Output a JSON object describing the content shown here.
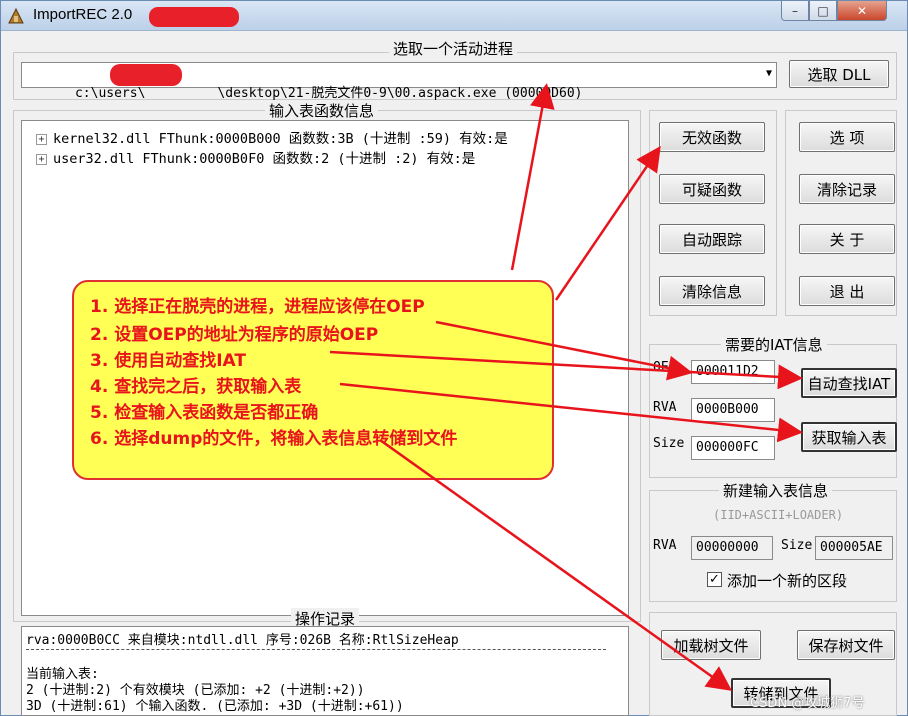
{
  "window": {
    "title": "ImportREC 2.0",
    "min": "–",
    "max": "□",
    "close": "✕"
  },
  "process": {
    "group_title": "选取一个活动进程",
    "path_a": "c:\\users\\",
    "path_b": "\\desktop\\21-脱壳文件0-9\\00.aspack.exe (00000D60)",
    "pick_dll": "选取 DLL"
  },
  "imports": {
    "group_title": "输入表函数信息",
    "items": [
      "kernel32.dll FThunk:0000B000 函数数:3B (十进制 :59) 有效:是",
      "user32.dll FThunk:0000B0F0 函数数:2 (十进制 :2) 有效:是"
    ]
  },
  "buttons": {
    "invalid": "无效函数",
    "options": "选   项",
    "suspect": "可疑函数",
    "clear_log": "清除记录",
    "auto_trace": "自动跟踪",
    "about": "关   于",
    "clear_info": "清除信息",
    "exit": "退   出",
    "iat_autosearch": "自动查找IAT",
    "get_imports": "获取输入表",
    "load_tree": "加载树文件",
    "save_tree": "保存树文件",
    "fix_dump": "转储到文件"
  },
  "iat": {
    "title": "需要的IAT信息",
    "oep_label": "OEP",
    "oep": "000011D2",
    "rva_label": "RVA",
    "rva": "0000B000",
    "size_label": "Size",
    "size": "000000FC"
  },
  "new_import": {
    "title": "新建输入表信息",
    "subtitle": "(IID+ASCII+LOADER)",
    "rva_label": "RVA",
    "rva": "00000000",
    "size_label": "Size",
    "size": "000005AE",
    "add_section": "添加一个新的区段",
    "check": "✓"
  },
  "log": {
    "title": "操作记录",
    "lines": [
      "rva:0000B0CC 来自模块:ntdll.dll 序号:026B 名称:RtlSizeHeap",
      "当前输入表:",
      "2 (十进制:2) 个有效模块 (已添加: +2 (十进制:+2))",
      "3D (十进制:61) 个输入函数. (已添加: +3D (十进制:+61))"
    ]
  },
  "callout": {
    "lines": [
      "1. 选择正在脱壳的进程，进程应该停在OEP",
      "2. 设置OEP的地址为程序的原始OEP",
      "3. 使用自动查找IAT",
      "4. 查找完之后，获取输入表",
      "5. 检查输入表函数是否都正确",
      "6. 选择dump的文件，将输入表信息转储到文件"
    ]
  },
  "watermark": "CSDN @攻城狮7号",
  "colors": {
    "accent_red": "#e8141c",
    "callout_bg": "#ffff55"
  }
}
